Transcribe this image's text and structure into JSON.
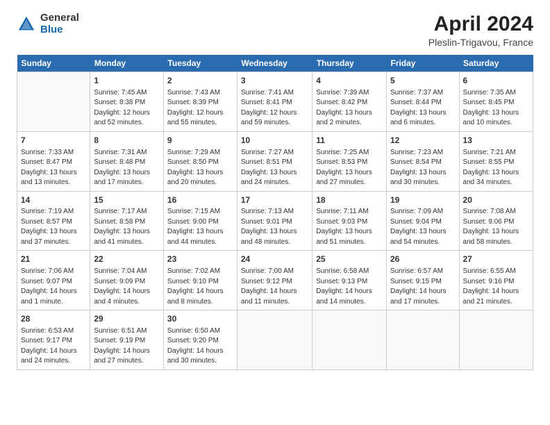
{
  "header": {
    "logo_general": "General",
    "logo_blue": "Blue",
    "title": "April 2024",
    "subtitle": "Pleslin-Trigavou, France"
  },
  "days_of_week": [
    "Sunday",
    "Monday",
    "Tuesday",
    "Wednesday",
    "Thursday",
    "Friday",
    "Saturday"
  ],
  "weeks": [
    [
      {
        "num": "",
        "info": ""
      },
      {
        "num": "1",
        "info": "Sunrise: 7:45 AM\nSunset: 8:38 PM\nDaylight: 12 hours\nand 52 minutes."
      },
      {
        "num": "2",
        "info": "Sunrise: 7:43 AM\nSunset: 8:39 PM\nDaylight: 12 hours\nand 55 minutes."
      },
      {
        "num": "3",
        "info": "Sunrise: 7:41 AM\nSunset: 8:41 PM\nDaylight: 12 hours\nand 59 minutes."
      },
      {
        "num": "4",
        "info": "Sunrise: 7:39 AM\nSunset: 8:42 PM\nDaylight: 13 hours\nand 2 minutes."
      },
      {
        "num": "5",
        "info": "Sunrise: 7:37 AM\nSunset: 8:44 PM\nDaylight: 13 hours\nand 6 minutes."
      },
      {
        "num": "6",
        "info": "Sunrise: 7:35 AM\nSunset: 8:45 PM\nDaylight: 13 hours\nand 10 minutes."
      }
    ],
    [
      {
        "num": "7",
        "info": "Sunrise: 7:33 AM\nSunset: 8:47 PM\nDaylight: 13 hours\nand 13 minutes."
      },
      {
        "num": "8",
        "info": "Sunrise: 7:31 AM\nSunset: 8:48 PM\nDaylight: 13 hours\nand 17 minutes."
      },
      {
        "num": "9",
        "info": "Sunrise: 7:29 AM\nSunset: 8:50 PM\nDaylight: 13 hours\nand 20 minutes."
      },
      {
        "num": "10",
        "info": "Sunrise: 7:27 AM\nSunset: 8:51 PM\nDaylight: 13 hours\nand 24 minutes."
      },
      {
        "num": "11",
        "info": "Sunrise: 7:25 AM\nSunset: 8:53 PM\nDaylight: 13 hours\nand 27 minutes."
      },
      {
        "num": "12",
        "info": "Sunrise: 7:23 AM\nSunset: 8:54 PM\nDaylight: 13 hours\nand 30 minutes."
      },
      {
        "num": "13",
        "info": "Sunrise: 7:21 AM\nSunset: 8:55 PM\nDaylight: 13 hours\nand 34 minutes."
      }
    ],
    [
      {
        "num": "14",
        "info": "Sunrise: 7:19 AM\nSunset: 8:57 PM\nDaylight: 13 hours\nand 37 minutes."
      },
      {
        "num": "15",
        "info": "Sunrise: 7:17 AM\nSunset: 8:58 PM\nDaylight: 13 hours\nand 41 minutes."
      },
      {
        "num": "16",
        "info": "Sunrise: 7:15 AM\nSunset: 9:00 PM\nDaylight: 13 hours\nand 44 minutes."
      },
      {
        "num": "17",
        "info": "Sunrise: 7:13 AM\nSunset: 9:01 PM\nDaylight: 13 hours\nand 48 minutes."
      },
      {
        "num": "18",
        "info": "Sunrise: 7:11 AM\nSunset: 9:03 PM\nDaylight: 13 hours\nand 51 minutes."
      },
      {
        "num": "19",
        "info": "Sunrise: 7:09 AM\nSunset: 9:04 PM\nDaylight: 13 hours\nand 54 minutes."
      },
      {
        "num": "20",
        "info": "Sunrise: 7:08 AM\nSunset: 9:06 PM\nDaylight: 13 hours\nand 58 minutes."
      }
    ],
    [
      {
        "num": "21",
        "info": "Sunrise: 7:06 AM\nSunset: 9:07 PM\nDaylight: 14 hours\nand 1 minute."
      },
      {
        "num": "22",
        "info": "Sunrise: 7:04 AM\nSunset: 9:09 PM\nDaylight: 14 hours\nand 4 minutes."
      },
      {
        "num": "23",
        "info": "Sunrise: 7:02 AM\nSunset: 9:10 PM\nDaylight: 14 hours\nand 8 minutes."
      },
      {
        "num": "24",
        "info": "Sunrise: 7:00 AM\nSunset: 9:12 PM\nDaylight: 14 hours\nand 11 minutes."
      },
      {
        "num": "25",
        "info": "Sunrise: 6:58 AM\nSunset: 9:13 PM\nDaylight: 14 hours\nand 14 minutes."
      },
      {
        "num": "26",
        "info": "Sunrise: 6:57 AM\nSunset: 9:15 PM\nDaylight: 14 hours\nand 17 minutes."
      },
      {
        "num": "27",
        "info": "Sunrise: 6:55 AM\nSunset: 9:16 PM\nDaylight: 14 hours\nand 21 minutes."
      }
    ],
    [
      {
        "num": "28",
        "info": "Sunrise: 6:53 AM\nSunset: 9:17 PM\nDaylight: 14 hours\nand 24 minutes."
      },
      {
        "num": "29",
        "info": "Sunrise: 6:51 AM\nSunset: 9:19 PM\nDaylight: 14 hours\nand 27 minutes."
      },
      {
        "num": "30",
        "info": "Sunrise: 6:50 AM\nSunset: 9:20 PM\nDaylight: 14 hours\nand 30 minutes."
      },
      {
        "num": "",
        "info": ""
      },
      {
        "num": "",
        "info": ""
      },
      {
        "num": "",
        "info": ""
      },
      {
        "num": "",
        "info": ""
      }
    ]
  ]
}
